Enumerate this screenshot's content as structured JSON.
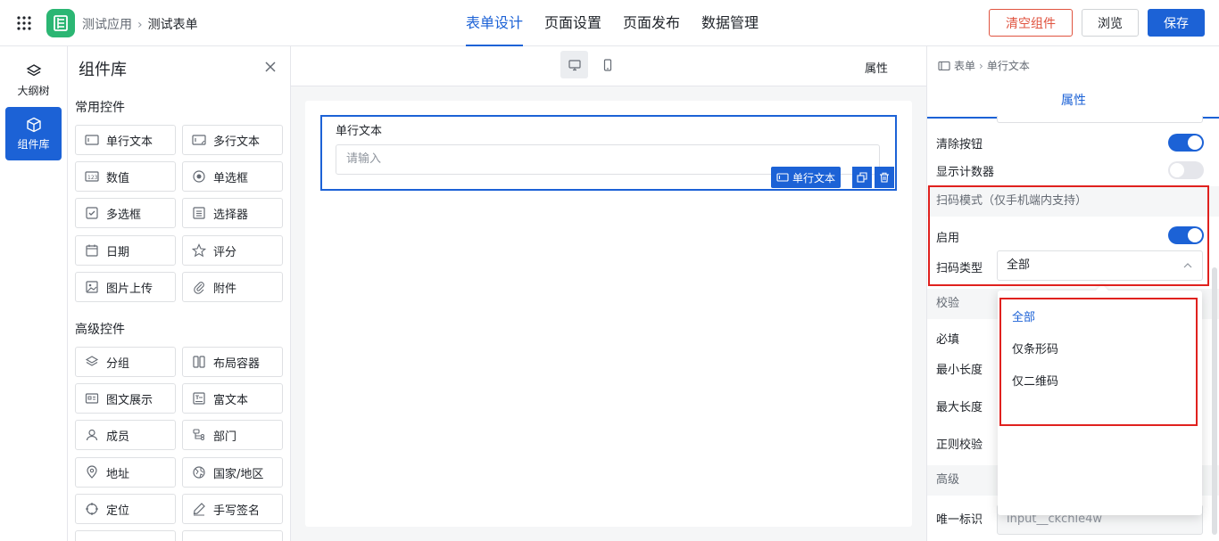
{
  "header": {
    "app_name": "测试应用",
    "form_name": "测试表单",
    "tabs": [
      {
        "label": "表单设计",
        "active": true
      },
      {
        "label": "页面设置",
        "active": false
      },
      {
        "label": "页面发布",
        "active": false
      },
      {
        "label": "数据管理",
        "active": false
      }
    ],
    "clear_label": "清空组件",
    "preview_label": "浏览",
    "save_label": "保存"
  },
  "rail": {
    "outline_label": "大纲树",
    "library_label": "组件库"
  },
  "library": {
    "title": "组件库",
    "common_title": "常用控件",
    "common": [
      {
        "label": "单行文本",
        "icon": "single-line-text-icon"
      },
      {
        "label": "多行文本",
        "icon": "multi-line-text-icon"
      },
      {
        "label": "数值",
        "icon": "number-icon"
      },
      {
        "label": "单选框",
        "icon": "radio-icon"
      },
      {
        "label": "多选框",
        "icon": "checkbox-icon"
      },
      {
        "label": "选择器",
        "icon": "select-icon"
      },
      {
        "label": "日期",
        "icon": "calendar-icon"
      },
      {
        "label": "评分",
        "icon": "star-icon"
      },
      {
        "label": "图片上传",
        "icon": "image-icon"
      },
      {
        "label": "附件",
        "icon": "paperclip-icon"
      }
    ],
    "advanced_title": "高级控件",
    "advanced": [
      {
        "label": "分组",
        "icon": "layers-icon"
      },
      {
        "label": "布局容器",
        "icon": "columns-icon"
      },
      {
        "label": "图文展示",
        "icon": "card-icon"
      },
      {
        "label": "富文本",
        "icon": "rich-text-icon"
      },
      {
        "label": "成员",
        "icon": "user-icon"
      },
      {
        "label": "部门",
        "icon": "org-icon"
      },
      {
        "label": "地址",
        "icon": "map-pin-icon"
      },
      {
        "label": "国家/地区",
        "icon": "globe-icon"
      },
      {
        "label": "定位",
        "icon": "crosshair-icon"
      },
      {
        "label": "手写签名",
        "icon": "pen-icon"
      }
    ]
  },
  "canvas": {
    "attr_label": "属性",
    "field_label": "单行文本",
    "field_placeholder": "请输入",
    "tag_label": "单行文本"
  },
  "props": {
    "crumb_root": "表单",
    "crumb_cur": "单行文本",
    "tab_label": "属性",
    "clear_btn_label": "清除按钮",
    "counter_label": "显示计数器",
    "scan_group": "扫码模式（仅手机端内支持）",
    "enable_label": "启用",
    "scan_type_label": "扫码类型",
    "scan_type_value": "全部",
    "validate_group": "校验",
    "required_label": "必填",
    "min_len_label": "最小长度",
    "max_len_label": "最大长度",
    "regex_label": "正则校验",
    "advanced_group": "高级",
    "uid_label": "唯一标识",
    "uid_value": "input__ckchle4w"
  },
  "dropdown": {
    "options": [
      "全部",
      "仅条形码",
      "仅二维码"
    ],
    "selected": "全部"
  },
  "colors": {
    "primary": "#1c62d6",
    "danger": "#e0533f",
    "app_logo": "#2bb673",
    "highlight": "#e0211e"
  }
}
